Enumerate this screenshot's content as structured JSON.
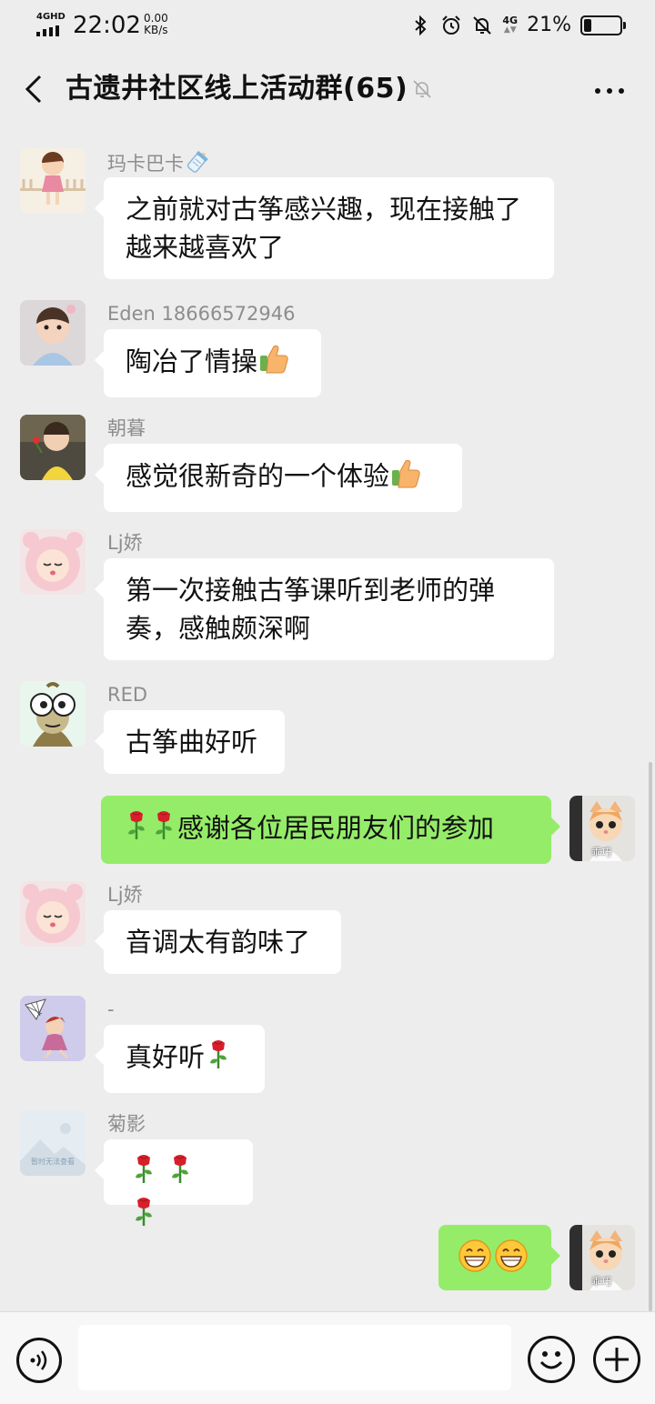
{
  "status_bar": {
    "network": "4GHD",
    "time": "22:02",
    "speed_value": "0.00",
    "speed_unit": "KB/s",
    "mobile_data": "4G",
    "battery_percent": "21%",
    "battery_level": 0.21
  },
  "header": {
    "title": "古遗井社区线上活动群(65)"
  },
  "messages": [
    {
      "sender": "玛卡巴卡",
      "text": "之前就对古筝感兴趣，现在接触了",
      "text2": "越来越喜欢了",
      "direction": "in"
    },
    {
      "sender": "Eden 18666572946",
      "text": "陶冶了情操",
      "direction": "in"
    },
    {
      "sender": "朝暮",
      "text": "感觉很新奇的一个体验",
      "direction": "in"
    },
    {
      "sender": "Lj娇",
      "text": "第一次接触古筝课听到老师的弹",
      "text2": "奏，感触颇深啊",
      "direction": "in"
    },
    {
      "sender": "RED",
      "text": "古筝曲好听",
      "direction": "in"
    },
    {
      "text": "感谢各位居民朋友们的参加",
      "direction": "out"
    },
    {
      "sender": "Lj娇",
      "text": "音调太有韵味了",
      "direction": "in"
    },
    {
      "sender": "-",
      "text": "真好听",
      "direction": "in"
    },
    {
      "sender": "菊影",
      "text": "",
      "direction": "in",
      "placeholder_avatar_text": "暂时无法查看"
    },
    {
      "text": "",
      "direction": "out"
    }
  ],
  "avatars": {
    "self_caption": "乖巧"
  },
  "input_bar": {
    "placeholder": ""
  },
  "colors": {
    "background": "#ededed",
    "bubble_in": "#ffffff",
    "bubble_out": "#95ec69",
    "sender_name": "#8d8d8d"
  },
  "icons": {
    "back": "chevron-left-icon",
    "mute": "bell-off-icon",
    "more": "more-dots-icon",
    "voice": "voice-icon",
    "emoji": "smiley-icon",
    "plus": "plus-icon",
    "thumbs_up": "thumbs-up-emoji",
    "rose": "rose-emoji",
    "grin": "grin-emoji",
    "baby_bottle": "baby-bottle-emoji"
  }
}
